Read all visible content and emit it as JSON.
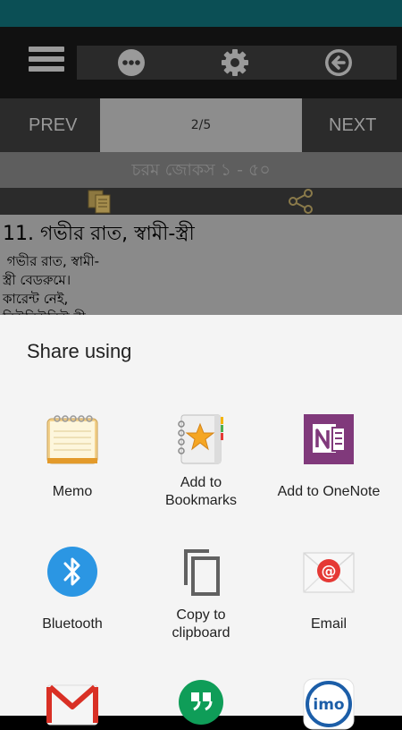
{
  "toolbar": {
    "menu_icon": "hamburger-menu-icon",
    "more_icon": "more-dots-icon",
    "settings_icon": "gear-icon",
    "back_icon": "back-arrow-icon"
  },
  "pager": {
    "prev_label": "PREV",
    "page_indicator": "2/5",
    "next_label": "NEXT"
  },
  "category_title": "চরম জোকস ১ - ৫০",
  "actions": {
    "copy_icon": "copy-icon",
    "share_icon": "share-icon"
  },
  "content": {
    "joke_title": "11.  গভীর রাত, স্বামী-স্ত্রী",
    "joke_body": " গভীর রাত, স্বামী-\nস্ত্রী বেডরুমে।\nকারেন্ট নেই,\nনিউনিউনিউ নী"
  },
  "share_sheet": {
    "title": "Share using",
    "items": [
      {
        "label": "Memo",
        "icon": "memo-notepad-icon"
      },
      {
        "label": "Add to\nBookmarks",
        "icon": "bookmarks-star-icon"
      },
      {
        "label": "Add to OneNote",
        "icon": "onenote-icon"
      },
      {
        "label": "Bluetooth",
        "icon": "bluetooth-icon"
      },
      {
        "label": "Copy to\nclipboard",
        "icon": "copy-clipboard-icon"
      },
      {
        "label": "Email",
        "icon": "email-icon"
      },
      {
        "label": "",
        "icon": "gmail-icon"
      },
      {
        "label": "",
        "icon": "hangouts-icon"
      },
      {
        "label": "",
        "icon": "imo-icon"
      }
    ]
  },
  "colors": {
    "status_bar": "#0b4f55",
    "onenote_purple": "#80397b",
    "bluetooth_blue": "#2b96e3",
    "hangouts_green": "#0f9d58",
    "imo_blue": "#1c5ea8",
    "gmail_red": "#d93025"
  }
}
